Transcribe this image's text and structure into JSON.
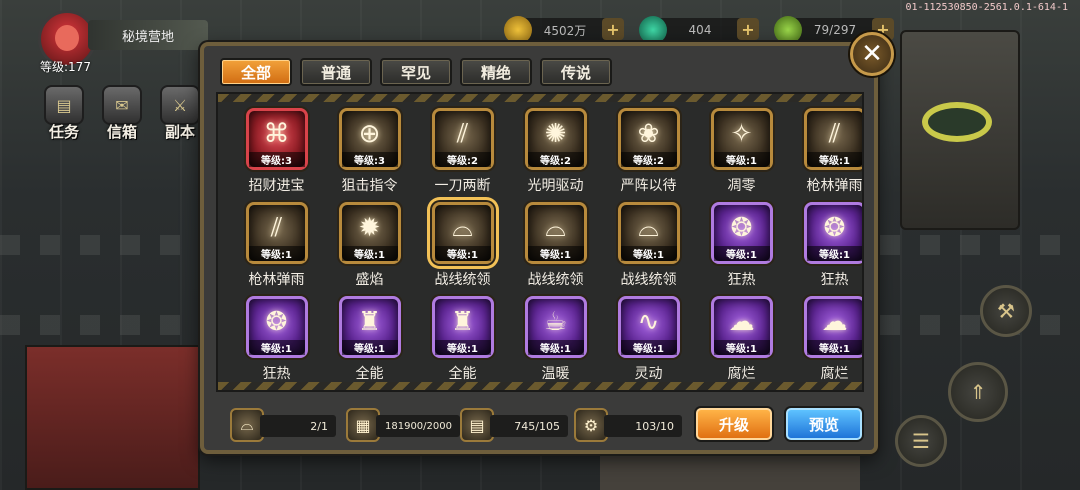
{
  "hud": {
    "location": "秘境营地",
    "player_level": "等级:177",
    "gold": "4502万",
    "gems": "404",
    "stamina": "79/297",
    "version": "01-112530850-2561.0.1-614-1"
  },
  "left_menu": [
    {
      "label": "任务",
      "icon": "task-icon"
    },
    {
      "label": "信箱",
      "icon": "mail-icon"
    },
    {
      "label": "副本",
      "icon": "dungeon-icon"
    }
  ],
  "tabs": [
    {
      "label": "全部",
      "active": true
    },
    {
      "label": "普通",
      "active": false
    },
    {
      "label": "罕见",
      "active": false
    },
    {
      "label": "精绝",
      "active": false
    },
    {
      "label": "传说",
      "active": false
    }
  ],
  "close_label": "✕",
  "skills": [
    {
      "name": "招财进宝",
      "level": "等级:3",
      "rarity": "red",
      "icon": "treasure-icon",
      "glyph": "⌘"
    },
    {
      "name": "狙击指令",
      "level": "等级:3",
      "rarity": "gold",
      "icon": "crosshair-icon",
      "glyph": "⊕"
    },
    {
      "name": "一刀两断",
      "level": "等级:2",
      "rarity": "gold",
      "icon": "slash-icon",
      "glyph": "⫽"
    },
    {
      "name": "光明驱动",
      "level": "等级:2",
      "rarity": "gold",
      "icon": "light-drive-icon",
      "glyph": "✺"
    },
    {
      "name": "严阵以待",
      "level": "等级:2",
      "rarity": "gold",
      "icon": "formation-icon",
      "glyph": "❀"
    },
    {
      "name": "凋零",
      "level": "等级:1",
      "rarity": "gold",
      "icon": "wither-icon",
      "glyph": "✧"
    },
    {
      "name": "枪林弹雨",
      "level": "等级:1",
      "rarity": "gold",
      "icon": "bullet-rain-icon",
      "glyph": "⫽"
    },
    {
      "name": "枪林弹雨",
      "level": "等级:1",
      "rarity": "gold",
      "icon": "bullet-rain-icon",
      "glyph": "⫽"
    },
    {
      "name": "盛焰",
      "level": "等级:1",
      "rarity": "gold",
      "icon": "flame-icon",
      "glyph": "✹"
    },
    {
      "name": "战线统领",
      "level": "等级:1",
      "rarity": "gold",
      "icon": "commander-helmet-icon",
      "glyph": "⌓",
      "selected": true
    },
    {
      "name": "战线统领",
      "level": "等级:1",
      "rarity": "gold",
      "icon": "commander-helmet-icon",
      "glyph": "⌓"
    },
    {
      "name": "战线统领",
      "level": "等级:1",
      "rarity": "gold",
      "icon": "commander-helmet-icon",
      "glyph": "⌓"
    },
    {
      "name": "狂热",
      "level": "等级:1",
      "rarity": "purple",
      "icon": "paw-icon",
      "glyph": "❂"
    },
    {
      "name": "狂热",
      "level": "等级:1",
      "rarity": "purple",
      "icon": "paw-icon",
      "glyph": "❂"
    },
    {
      "name": "狂热",
      "level": "等级:1",
      "rarity": "purple",
      "icon": "paw-icon",
      "glyph": "❂"
    },
    {
      "name": "全能",
      "level": "等级:1",
      "rarity": "purple",
      "icon": "armor-icon",
      "glyph": "♜"
    },
    {
      "name": "全能",
      "level": "等级:1",
      "rarity": "purple",
      "icon": "armor-icon",
      "glyph": "♜"
    },
    {
      "name": "温暖",
      "level": "等级:1",
      "rarity": "purple",
      "icon": "warm-cup-icon",
      "glyph": "☕"
    },
    {
      "name": "灵动",
      "level": "等级:1",
      "rarity": "purple",
      "icon": "swirl-icon",
      "glyph": "∿"
    },
    {
      "name": "腐烂",
      "level": "等级:1",
      "rarity": "purple",
      "icon": "rot-cloud-icon",
      "glyph": "☁"
    },
    {
      "name": "腐烂",
      "level": "等级:1",
      "rarity": "purple",
      "icon": "rot-cloud-icon",
      "glyph": "☁"
    }
  ],
  "materials": [
    {
      "icon": "helmet-material-icon",
      "value": "2/1"
    },
    {
      "icon": "blueprint-material-icon",
      "value": "181900/2000"
    },
    {
      "icon": "book-material-icon",
      "value": "745/105"
    },
    {
      "icon": "gear-material-icon",
      "value": "103/10"
    }
  ],
  "buttons": {
    "upgrade": "升级",
    "preview": "预览"
  },
  "colors": {
    "tab_active": "#e88b24",
    "upgrade_btn": "#f08f2a",
    "preview_btn": "#2f8fe6",
    "rarity_red": "#d9434a",
    "rarity_gold": "#b88a3c",
    "rarity_purple": "#b07be0"
  }
}
